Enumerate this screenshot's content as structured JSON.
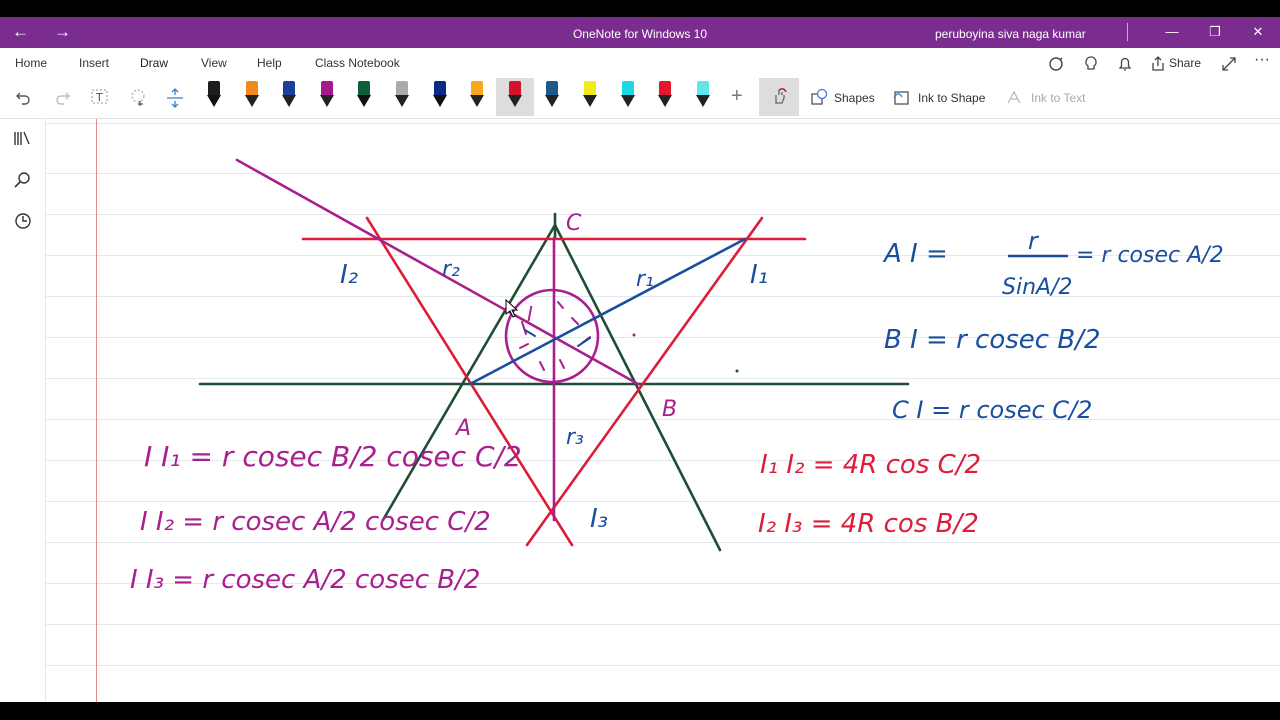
{
  "titlebar": {
    "back_icon": "←",
    "forward_icon": "→",
    "title": "OneNote for Windows 10",
    "user": "peruboyina siva naga kumar",
    "minimize": "—",
    "restore": "❐",
    "close": "✕"
  },
  "ribbon": {
    "tabs": [
      {
        "label": "Home"
      },
      {
        "label": "Insert"
      },
      {
        "label": "Draw"
      },
      {
        "label": "View"
      },
      {
        "label": "Help"
      },
      {
        "label": "Class Notebook"
      }
    ],
    "active_tab": "Draw",
    "share_label": "Share"
  },
  "toolbar": {
    "pens": [
      {
        "color": "#1d1d1d"
      },
      {
        "color": "#f08a1c"
      },
      {
        "color": "#1d3f9c"
      },
      {
        "color": "#a4198b"
      },
      {
        "color": "#115e3a"
      },
      {
        "color": "#aaaaaa"
      },
      {
        "color": "#0b2a86"
      },
      {
        "color": "#f7a81b"
      },
      {
        "color": "#d4122b"
      },
      {
        "color": "#1d5a8a"
      },
      {
        "color": "#f2ea1a"
      },
      {
        "color": "#19d8e0"
      },
      {
        "color": "#e4172e"
      },
      {
        "color": "#5fe6e8"
      }
    ],
    "selected_pen": 8,
    "shapes_label": "Shapes",
    "ink_to_shape_label": "Ink to Shape",
    "ink_to_text_label": "Ink to Text"
  },
  "sidebar": {
    "icons": [
      "notebooks-icon",
      "search-icon",
      "recent-icon"
    ]
  },
  "ink": {
    "colors": {
      "blue": "#1a4fa0",
      "red": "#dd1c3a",
      "magenta": "#a8208e",
      "green": "#1f4d35"
    },
    "labels": {
      "C": "C",
      "I2": "I₂",
      "r2": "r₂",
      "r1": "r₁",
      "I1": "I₁",
      "I": "I",
      "A": "A",
      "B": "B",
      "r3": "r₃",
      "I3": "I₃"
    },
    "formulas": {
      "ai_lhs": "A I  =",
      "ai_num": "r",
      "ai_den": "SinA/2",
      "ai_rhs": "= r cosec A/2",
      "bi": "B I  =  r cosec B/2",
      "ci": "C I  = r  cosec C/2",
      "i1i2": "I₁ I₂ = 4R cos C/2",
      "i2i3": "I₂ I₃  = 4R cos B/2",
      "ii1": "I I₁ = r cosec B/2 cosec C/2",
      "ii2": "I I₂  = r cosec A/2 cosec C/2",
      "ii3": "I I₃  = r  cosec A/2  cosec B/2"
    }
  }
}
